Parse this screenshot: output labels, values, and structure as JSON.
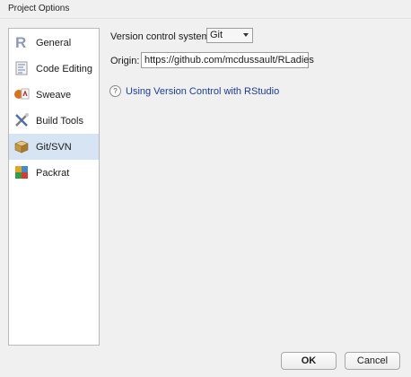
{
  "window": {
    "title": "Project Options"
  },
  "sidebar": {
    "items": [
      {
        "label": "General",
        "icon": "r-logo-icon",
        "active": false
      },
      {
        "label": "Code Editing",
        "icon": "code-page-icon",
        "active": false
      },
      {
        "label": "Sweave",
        "icon": "sweave-icon",
        "active": false
      },
      {
        "label": "Build Tools",
        "icon": "build-tools-icon",
        "active": false
      },
      {
        "label": "Git/SVN",
        "icon": "git-box-icon",
        "active": true
      },
      {
        "label": "Packrat",
        "icon": "packrat-icon",
        "active": false
      }
    ]
  },
  "vcs": {
    "label": "Version control system:",
    "selected": "Git"
  },
  "origin": {
    "label": "Origin:",
    "value": "https://github.com/mcdussault/RLadies"
  },
  "help": {
    "icon_glyph": "?",
    "text": "Using Version Control with RStudio"
  },
  "buttons": {
    "ok": "OK",
    "cancel": "Cancel"
  },
  "colors": {
    "active_bg": "#d7e4f3",
    "link": "#1e3c9b"
  }
}
